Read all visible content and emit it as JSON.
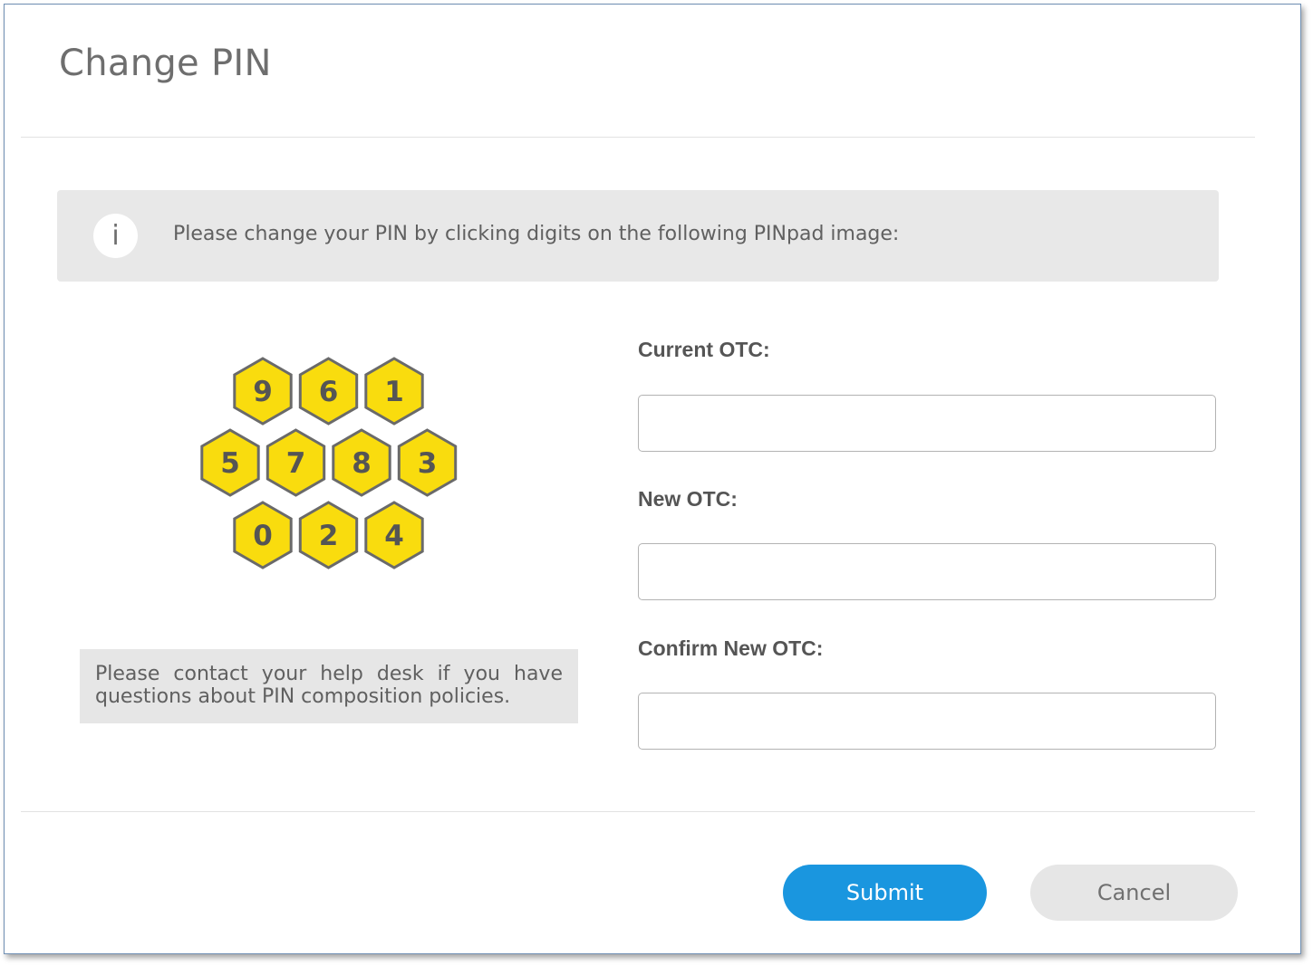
{
  "dialog": {
    "title": "Change PIN"
  },
  "info": {
    "icon": "info-icon",
    "icon_glyph": "i",
    "message": "Please change your PIN by clicking digits on the following PINpad image:"
  },
  "pinpad": {
    "rows": [
      [
        "9",
        "6",
        "1"
      ],
      [
        "5",
        "7",
        "8",
        "3"
      ],
      [
        "0",
        "2",
        "4"
      ]
    ],
    "fill_color": "#f9dc0e",
    "stroke_color": "#6a6a6a",
    "text_color": "#555555"
  },
  "note": {
    "text": "Please contact your help desk if you have questions about PIN composition policies."
  },
  "form": {
    "current_label": "Current OTC:",
    "new_label": "New OTC:",
    "confirm_label": "Confirm New OTC:",
    "current_value": "",
    "new_value": "",
    "confirm_value": ""
  },
  "buttons": {
    "submit_label": "Submit",
    "cancel_label": "Cancel"
  },
  "colors": {
    "submit": "#1a96df",
    "cancel": "#e6e6e6"
  }
}
